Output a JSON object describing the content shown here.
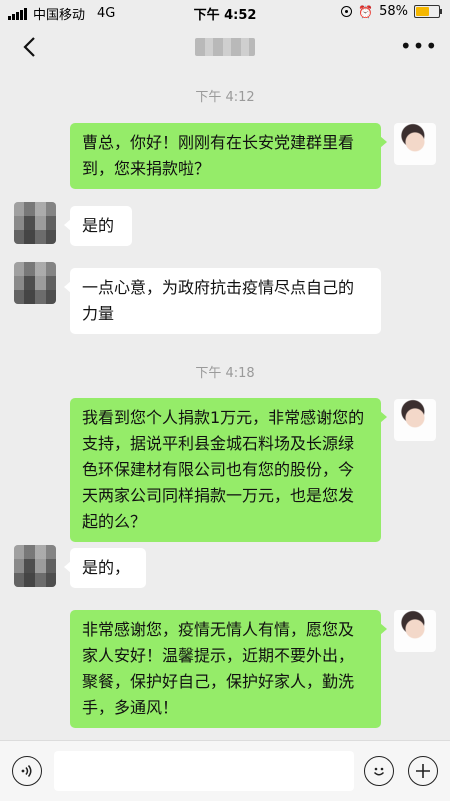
{
  "status_bar": {
    "carrier": "中国移动",
    "network": "4G",
    "time": "下午 4:52",
    "battery_percent": "58%",
    "battery_level": 0.58
  },
  "nav": {
    "back_icon": "chevron-left-icon",
    "more_icon": "more-dots-icon"
  },
  "messages": [
    {
      "type": "time",
      "text": "下午 4:12"
    },
    {
      "type": "sent",
      "text": "曹总，你好！刚刚有在长安党建群里看到，您来捐款啦？"
    },
    {
      "type": "received",
      "text": "是的"
    },
    {
      "type": "received",
      "text": "一点心意，为政府抗击疫情尽点自己的力量"
    },
    {
      "type": "time",
      "text": "下午 4:18"
    },
    {
      "type": "sent",
      "text": "我看到您个人捐款1万元，非常感谢您的支持，据说平利县金城石料场及长源绿色环保建材有限公司也有您的股份，今天两家公司同样捐款一万元，也是您发起的么？"
    },
    {
      "type": "received",
      "text": "是的，"
    },
    {
      "type": "sent",
      "text": "非常感谢您，疫情无情人有情，愿您及家人安好！温馨提示，近期不要外出，聚餐，保护好自己，保护好家人，勤洗手，多通风！"
    }
  ],
  "input_bar": {
    "value": "",
    "voice_icon": "voice-icon",
    "emoji_icon": "emoji-icon",
    "plus_icon": "plus-icon"
  },
  "colors": {
    "sent_bubble": "#95ec69",
    "received_bubble": "#ffffff",
    "background": "#ededed"
  }
}
